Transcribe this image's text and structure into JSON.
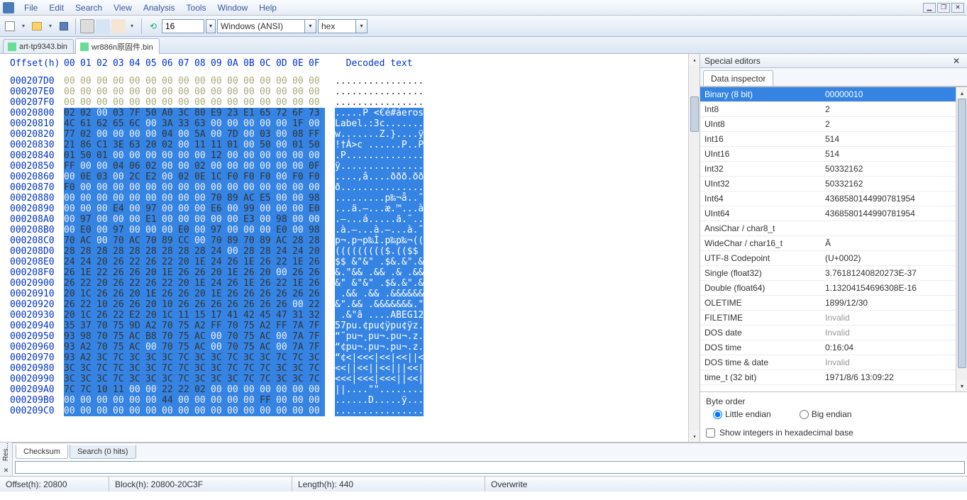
{
  "menubar": {
    "items": [
      "File",
      "Edit",
      "Search",
      "View",
      "Analysis",
      "Tools",
      "Window",
      "Help"
    ]
  },
  "toolbar": {
    "columns_value": "16",
    "encoding": "Windows (ANSI)",
    "numbase": "hex"
  },
  "tabs": [
    {
      "label": "art-tp9343.bin",
      "active": false
    },
    {
      "label": "wr886n原固件.bin",
      "active": true
    }
  ],
  "hex": {
    "header_offset": "Offset(h)",
    "header_cols": [
      "00",
      "01",
      "02",
      "03",
      "04",
      "05",
      "06",
      "07",
      "08",
      "09",
      "0A",
      "0B",
      "0C",
      "0D",
      "0E",
      "0F"
    ],
    "header_decoded": "Decoded text",
    "rows": [
      {
        "o": "000207D0",
        "b": [
          "00",
          "00",
          "00",
          "00",
          "00",
          "00",
          "00",
          "00",
          "00",
          "00",
          "00",
          "00",
          "00",
          "00",
          "00",
          "00"
        ],
        "d": "................",
        "sel": false
      },
      {
        "o": "000207E0",
        "b": [
          "00",
          "00",
          "00",
          "00",
          "00",
          "00",
          "00",
          "00",
          "00",
          "00",
          "00",
          "00",
          "00",
          "00",
          "00",
          "00"
        ],
        "d": "................",
        "sel": false
      },
      {
        "o": "000207F0",
        "b": [
          "00",
          "00",
          "00",
          "00",
          "00",
          "00",
          "00",
          "00",
          "00",
          "00",
          "00",
          "00",
          "00",
          "00",
          "00",
          "00"
        ],
        "d": "................",
        "sel": false
      },
      {
        "o": "00020800",
        "b": [
          "02",
          "02",
          "00",
          "03",
          "7F",
          "50",
          "A0",
          "3C",
          "80",
          "E9",
          "23",
          "E1",
          "65",
          "72",
          "6F",
          "73"
        ],
        "d": ".....P <€é#áeros",
        "sel": true
      },
      {
        "o": "00020810",
        "b": [
          "4C",
          "61",
          "62",
          "65",
          "6C",
          "00",
          "3A",
          "33",
          "63",
          "00",
          "00",
          "00",
          "00",
          "00",
          "1F",
          "00"
        ],
        "d": "Label.:3c.......",
        "sel": true
      },
      {
        "o": "00020820",
        "b": [
          "77",
          "02",
          "00",
          "00",
          "00",
          "00",
          "04",
          "00",
          "5A",
          "00",
          "7D",
          "00",
          "03",
          "00",
          "08",
          "FF"
        ],
        "d": "w.......Z.}....ÿ",
        "sel": true
      },
      {
        "o": "00020830",
        "b": [
          "21",
          "86",
          "C1",
          "3E",
          "63",
          "20",
          "02",
          "00",
          "11",
          "11",
          "01",
          "00",
          "50",
          "00",
          "01",
          "50"
        ],
        "d": "!†Á>c ......P..P",
        "sel": true
      },
      {
        "o": "00020840",
        "b": [
          "01",
          "50",
          "01",
          "00",
          "00",
          "00",
          "00",
          "00",
          "00",
          "12",
          "00",
          "00",
          "00",
          "00",
          "00",
          "00"
        ],
        "d": ".P..............",
        "sel": true
      },
      {
        "o": "00020850",
        "b": [
          "FF",
          "00",
          "00",
          "04",
          "06",
          "02",
          "00",
          "00",
          "02",
          "00",
          "00",
          "00",
          "00",
          "00",
          "00",
          "0F"
        ],
        "d": "ÿ...............",
        "sel": true
      },
      {
        "o": "00020860",
        "b": [
          "00",
          "0E",
          "03",
          "00",
          "2C",
          "E2",
          "00",
          "02",
          "0E",
          "1C",
          "F0",
          "F0",
          "F0",
          "00",
          "F0",
          "F0"
        ],
        "d": "....,â....ððð.ðð",
        "sel": true
      },
      {
        "o": "00020870",
        "b": [
          "F0",
          "00",
          "00",
          "00",
          "00",
          "00",
          "00",
          "00",
          "00",
          "00",
          "00",
          "00",
          "00",
          "00",
          "00",
          "00"
        ],
        "d": "ð...............",
        "sel": true
      },
      {
        "o": "00020880",
        "b": [
          "00",
          "00",
          "00",
          "00",
          "00",
          "00",
          "00",
          "00",
          "00",
          "70",
          "89",
          "AC",
          "E5",
          "00",
          "00",
          "98"
        ],
        "d": ".........p‰¬å..˜",
        "sel": true
      },
      {
        "o": "00020890",
        "b": [
          "00",
          "00",
          "00",
          "E4",
          "00",
          "97",
          "00",
          "00",
          "00",
          "E6",
          "00",
          "99",
          "00",
          "00",
          "00",
          "E0"
        ],
        "d": "...ä.—...æ.™...à",
        "sel": true
      },
      {
        "o": "000208A0",
        "b": [
          "00",
          "97",
          "00",
          "00",
          "00",
          "E1",
          "00",
          "00",
          "00",
          "00",
          "00",
          "E3",
          "00",
          "98",
          "00",
          "00"
        ],
        "d": ".—...á.....ã.˜..",
        "sel": true
      },
      {
        "o": "000208B0",
        "b": [
          "00",
          "E0",
          "00",
          "97",
          "00",
          "00",
          "00",
          "E0",
          "00",
          "97",
          "00",
          "00",
          "00",
          "E0",
          "00",
          "98"
        ],
        "d": ".à.—...à.—...à.˜",
        "sel": true
      },
      {
        "o": "000208C0",
        "b": [
          "70",
          "AC",
          "00",
          "70",
          "AC",
          "70",
          "89",
          "CC",
          "00",
          "70",
          "89",
          "70",
          "89",
          "AC",
          "28",
          "28"
        ],
        "d": "p¬.p¬p‰Ì.p‰p‰¬((",
        "sel": true
      },
      {
        "o": "000208D0",
        "b": [
          "28",
          "28",
          "28",
          "28",
          "28",
          "28",
          "28",
          "28",
          "28",
          "24",
          "00",
          "28",
          "28",
          "24",
          "24",
          "20"
        ],
        "d": "((((((((($.(($$ ",
        "sel": true
      },
      {
        "o": "000208E0",
        "b": [
          "24",
          "24",
          "20",
          "26",
          "22",
          "26",
          "22",
          "20",
          "1E",
          "24",
          "26",
          "1E",
          "26",
          "22",
          "1E",
          "26"
        ],
        "d": "$$ &\"&\" .$&.&\".&",
        "sel": true
      },
      {
        "o": "000208F0",
        "b": [
          "26",
          "1E",
          "22",
          "26",
          "26",
          "20",
          "1E",
          "26",
          "26",
          "20",
          "1E",
          "26",
          "20",
          "00",
          "26",
          "26"
        ],
        "d": "&.\"&& .&& .& .&&",
        "sel": true
      },
      {
        "o": "00020900",
        "b": [
          "26",
          "22",
          "20",
          "26",
          "22",
          "26",
          "22",
          "20",
          "1E",
          "24",
          "26",
          "1E",
          "26",
          "22",
          "1E",
          "26"
        ],
        "d": "&\" &\"&\" .$&.&\".&",
        "sel": true
      },
      {
        "o": "00020910",
        "b": [
          "20",
          "1C",
          "26",
          "26",
          "20",
          "1E",
          "26",
          "26",
          "20",
          "1E",
          "26",
          "26",
          "26",
          "26",
          "26",
          "26"
        ],
        "d": " .&& .&& .&&&&&&",
        "sel": true
      },
      {
        "o": "00020920",
        "b": [
          "26",
          "22",
          "10",
          "26",
          "26",
          "20",
          "10",
          "26",
          "26",
          "26",
          "26",
          "26",
          "26",
          "26",
          "00",
          "22"
        ],
        "d": "&\".&& .&&&&&&&.\"",
        "sel": true
      },
      {
        "o": "00020930",
        "b": [
          "20",
          "1C",
          "26",
          "22",
          "E2",
          "20",
          "1C",
          "11",
          "15",
          "17",
          "41",
          "42",
          "45",
          "47",
          "31",
          "32"
        ],
        "d": " .&\"â ....ABEG12",
        "sel": true
      },
      {
        "o": "00020940",
        "b": [
          "35",
          "37",
          "70",
          "75",
          "9D",
          "A2",
          "70",
          "75",
          "A2",
          "FF",
          "70",
          "75",
          "A2",
          "FF",
          "7A",
          "7F"
        ],
        "d": "57pu.¢pu¢ÿpu¢ÿz.",
        "sel": true
      },
      {
        "o": "00020950",
        "b": [
          "93",
          "98",
          "70",
          "75",
          "AC",
          "B8",
          "70",
          "75",
          "AC",
          "00",
          "70",
          "75",
          "AC",
          "00",
          "7A",
          "7F"
        ],
        "d": "“˜pu¬¸pu¬.pu¬.z.",
        "sel": true
      },
      {
        "o": "00020960",
        "b": [
          "93",
          "A2",
          "70",
          "75",
          "AC",
          "00",
          "70",
          "75",
          "AC",
          "00",
          "70",
          "75",
          "AC",
          "00",
          "7A",
          "7F"
        ],
        "d": "“¢pu¬.pu¬.pu¬.z.",
        "sel": true
      },
      {
        "o": "00020970",
        "b": [
          "93",
          "A2",
          "3C",
          "7C",
          "3C",
          "3C",
          "3C",
          "7C",
          "3C",
          "3C",
          "7C",
          "3C",
          "3C",
          "7C",
          "7C",
          "3C"
        ],
        "d": "“¢<|<<<|<<|<<||<",
        "sel": true
      },
      {
        "o": "00020980",
        "b": [
          "3C",
          "3C",
          "7C",
          "7C",
          "3C",
          "3C",
          "7C",
          "7C",
          "3C",
          "3C",
          "7C",
          "7C",
          "7C",
          "3C",
          "3C",
          "7C"
        ],
        "d": "<<||<<||<<|||<<|",
        "sel": true
      },
      {
        "o": "00020990",
        "b": [
          "3C",
          "3C",
          "3C",
          "7C",
          "3C",
          "3C",
          "3C",
          "7C",
          "3C",
          "3C",
          "3C",
          "7C",
          "7C",
          "3C",
          "3C",
          "7C"
        ],
        "d": "<<<|<<<|<<<||<<|",
        "sel": true
      },
      {
        "o": "000209A0",
        "b": [
          "7C",
          "7C",
          "10",
          "11",
          "00",
          "00",
          "22",
          "22",
          "02",
          "00",
          "00",
          "00",
          "00",
          "00",
          "00",
          "00"
        ],
        "d": "||....\"\"........",
        "sel": true
      },
      {
        "o": "000209B0",
        "b": [
          "00",
          "00",
          "00",
          "00",
          "00",
          "00",
          "44",
          "00",
          "00",
          "00",
          "00",
          "00",
          "FF",
          "00",
          "00",
          "00"
        ],
        "d": "......D.....ÿ...",
        "sel": true
      },
      {
        "o": "000209C0",
        "b": [
          "00",
          "00",
          "00",
          "00",
          "00",
          "00",
          "00",
          "00",
          "00",
          "00",
          "00",
          "00",
          "00",
          "00",
          "00",
          "00"
        ],
        "d": "................",
        "sel": true
      }
    ]
  },
  "side": {
    "title": "Special editors",
    "tab": "Data inspector",
    "rows": [
      {
        "k": "Binary (8 bit)",
        "v": "00000010",
        "sel": true
      },
      {
        "k": "Int8",
        "v": "2"
      },
      {
        "k": "UInt8",
        "v": "2"
      },
      {
        "k": "Int16",
        "v": "514"
      },
      {
        "k": "UInt16",
        "v": "514"
      },
      {
        "k": "Int32",
        "v": "50332162"
      },
      {
        "k": "UInt32",
        "v": "50332162"
      },
      {
        "k": "Int64",
        "v": "4368580144990781954"
      },
      {
        "k": "UInt64",
        "v": "4368580144990781954"
      },
      {
        "k": "AnsiChar / char8_t",
        "v": ""
      },
      {
        "k": "WideChar / char16_t",
        "v": "Ă"
      },
      {
        "k": "UTF-8 Codepoint",
        "v": "  (U+0002)"
      },
      {
        "k": "Single (float32)",
        "v": "3.76181240820273E-37"
      },
      {
        "k": "Double (float64)",
        "v": "1.13204154696308E-16"
      },
      {
        "k": "OLETIME",
        "v": "1899/12/30"
      },
      {
        "k": "FILETIME",
        "v": "Invalid",
        "inv": true
      },
      {
        "k": "DOS date",
        "v": "Invalid",
        "inv": true
      },
      {
        "k": "DOS time",
        "v": "0:16:04"
      },
      {
        "k": "DOS time & date",
        "v": "Invalid",
        "inv": true
      },
      {
        "k": "time_t (32 bit)",
        "v": "1971/8/6 13:09:22"
      }
    ],
    "byteorder": {
      "label": "Byte order",
      "little": "Little endian",
      "big": "Big endian",
      "current": "little"
    },
    "hexopt": "Show integers in hexadecimal base"
  },
  "bottom": {
    "vtab": "Res...",
    "tabs": [
      {
        "label": "Checksum",
        "active": true
      },
      {
        "label": "Search (0 hits)",
        "active": false
      }
    ]
  },
  "status": {
    "offset": "Offset(h): 20800",
    "block": "Block(h): 20800-20C3F",
    "length": "Length(h): 440",
    "mode": "Overwrite"
  }
}
